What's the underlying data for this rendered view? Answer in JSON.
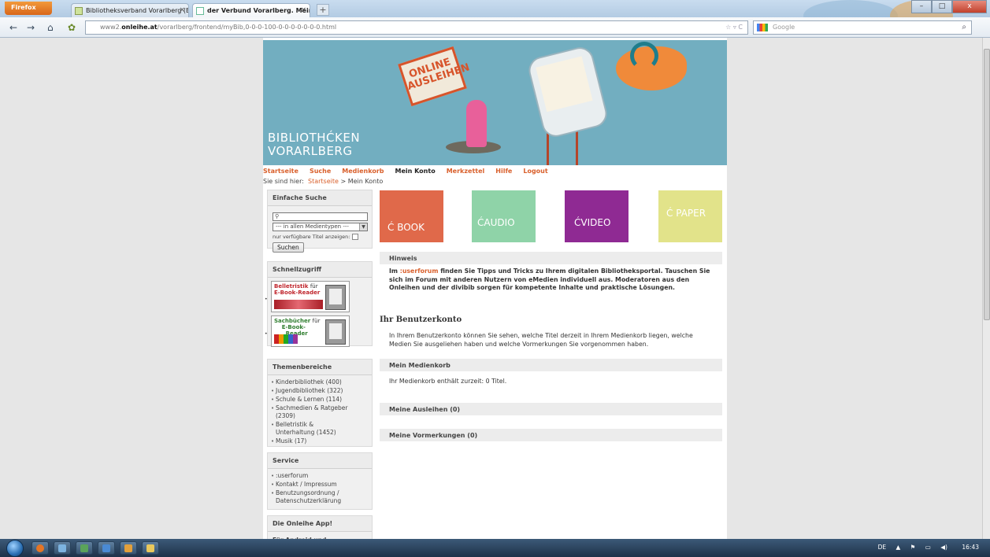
{
  "browser": {
    "app_button": "Firefox",
    "tabs": [
      {
        "label": "Bibliotheksverband Vorarlberg (BVV)",
        "close": "×"
      },
      {
        "label": "der Verbund Vorarlberg. Mein Konto",
        "close": "×"
      }
    ],
    "new_tab": "+",
    "window_buttons": {
      "minimize": "–",
      "maximize": "□",
      "close": "x"
    },
    "nav": {
      "back": "←",
      "forward": "→",
      "home": "⌂"
    },
    "url": {
      "prefix": "www2.",
      "domain": "onleihe.at",
      "path": "/vorarlberg/frontend/myBib,0-0-0-100-0-0-0-0-0-0-0.html"
    },
    "search_placeholder": "Google",
    "url_star": "☆ ▿ C"
  },
  "banner": {
    "brand_line1": "BIBLIOTHĆKEN",
    "brand_line2": "VORARLBERG",
    "sign_line1": "ONLINE",
    "sign_line2": "AUSLEIHEN"
  },
  "topnav": [
    {
      "label": "Startseite",
      "current": false
    },
    {
      "label": "Suche",
      "current": false
    },
    {
      "label": "Medienkorb",
      "current": false
    },
    {
      "label": "Mein Konto",
      "current": true
    },
    {
      "label": "Merkzettel",
      "current": false
    },
    {
      "label": "Hilfe",
      "current": false
    },
    {
      "label": "Logout",
      "current": false
    }
  ],
  "breadcrumb": {
    "prefix": "Sie sind hier:",
    "home": "Startseite",
    "separator": ">",
    "current": "Mein Konto"
  },
  "sidebar": {
    "search": {
      "title": "Einfache Suche",
      "input_value": "",
      "select_value": "--- in allen Medientypen ---",
      "checkbox_label": "nur verfügbare Titel anzeigen:",
      "button": "Suchen"
    },
    "quick": {
      "title": "Schnellzugriff",
      "promo1": {
        "line1": "Belletristik",
        "suffix": "für",
        "line2": "E-Book-Reader"
      },
      "promo2": {
        "line1": "Sachbücher",
        "suffix": "für",
        "line2": "E-Book-",
        "line3": "Reader"
      }
    },
    "topics": {
      "title": "Themenbereiche",
      "items": [
        "Kinderbibliothek (400)",
        "Jugendbibliothek (322)",
        "Schule & Lernen (114)",
        "Sachmedien & Ratgeber (2309)",
        "Belletristik & Unterhaltung (1452)",
        "Musik (17)"
      ]
    },
    "service": {
      "title": "Service",
      "items": [
        ":userforum",
        "Kontakt / Impressum",
        "Benutzungsordnung / Datenschutzerklärung"
      ]
    },
    "app": {
      "title": "Die Onleihe App!",
      "text": "Für Android und iPhone/iPad"
    }
  },
  "tiles": [
    {
      "label": "BOOK",
      "color": "#e0694a"
    },
    {
      "label": "AUDIO",
      "color": "#8fd3a8"
    },
    {
      "label": "VIDEO",
      "color": "#8f2a93"
    },
    {
      "label": "PAPER",
      "color": "#e2e38a"
    }
  ],
  "tile_mark": "Ć",
  "hinweis": {
    "title": "Hinweis",
    "text_before": "Im",
    "link": ":userforum",
    "text_after": "finden Sie Tipps und Tricks zu Ihrem digitalen Bibliotheksportal. Tauschen Sie sich im Forum mit anderen Nutzern von eMedien individuell aus. Moderatoren aus den Onleihen und der divibib sorgen für kompetente Inhalte und praktische Lösungen."
  },
  "account": {
    "title": "Ihr Benutzerkonto",
    "intro": "In Ihrem Benutzerkonto können Sie sehen, welche Titel derzeit in Ihrem Medienkorb liegen, welche Medien Sie ausgeliehen haben und welche Vormerkungen Sie vorgenommen haben.",
    "medienkorb_title": "Mein Medienkorb",
    "medienkorb_text": "Ihr Medienkorb enthält zurzeit: 0 Titel.",
    "ausleihen_title": "Meine Ausleihen (0)",
    "vormerkungen_title": "Meine Vormerkungen (0)"
  },
  "taskbar": {
    "lang": "DE",
    "time": "16:43"
  }
}
